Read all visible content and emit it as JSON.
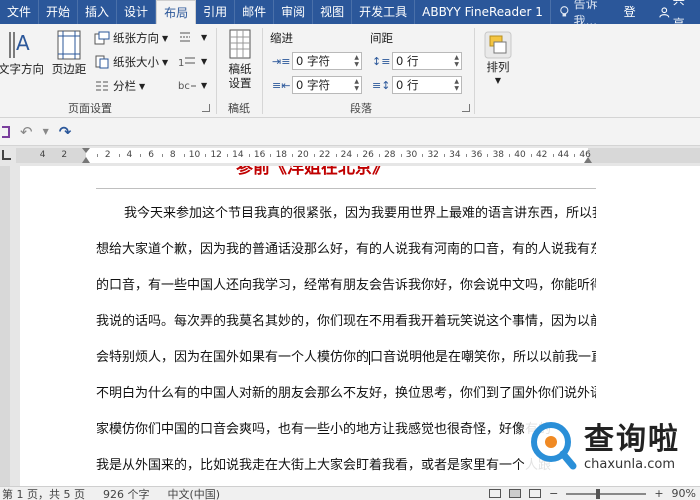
{
  "menu": {
    "tabs": [
      "文件",
      "开始",
      "插入",
      "设计",
      "布局",
      "引用",
      "邮件",
      "审阅",
      "视图",
      "开发工具",
      "ABBYY FineReader 1"
    ],
    "active_tab": "布局",
    "tell_me": "告诉我...",
    "login": "登录",
    "share": "共享"
  },
  "ribbon": {
    "page_setup": {
      "label": "页面设置",
      "text_direction": "文字方向",
      "margins": "页边距",
      "orientation": "纸张方向",
      "size": "纸张大小",
      "columns": "分栏"
    },
    "draft": {
      "label": "稿纸",
      "button": "稿纸\n设置",
      "btn_line1": "稿纸",
      "btn_line2": "设置"
    },
    "paragraph": {
      "label": "段落",
      "indent_label": "缩进",
      "spacing_label": "间距",
      "indent_left": "0 字符",
      "indent_right": "0 字符",
      "spacing_before": "0 行",
      "spacing_after": "0 行"
    },
    "arrange": {
      "label": "排列"
    }
  },
  "document": {
    "heading": "参前《洋姐在北京》",
    "lines": [
      "我今天来参加这个节目我真的很紧张，因为我要用世界上最难的语言讲东西，所以我",
      "想给大家道个歉，因为我的普通话没那么好，有的人说我有河南的口音，有的人说我有东北",
      "的口音，有一些中国人还向我学习，经常有朋友会告诉我你好，你会说中文吗，你能听得懂",
      "我说的话吗。每次弄的我莫名其妙的，你们现在不用看我开着玩笑说这个事情，因为以前我",
      "会特别烦人，因为在国外如果有一个人模仿你的",
      "不明白为什么有的中国人对新的朋友会那么不友好，换位思考，你们到了国外你们说外语大",
      "家模仿你们中国的口音会爽吗，也有一些小的地方让我感觉也很奇怪，好像有的",
      "我是从外国来的，比如说我走在大街上大家会盯着我看，或者是家里有一个人跟"
    ],
    "line5_after_cursor": "口音说明他是在嘲笑你，所以以前我一直搞"
  },
  "ruler": {
    "left_labels": [
      "4",
      "2"
    ],
    "labels": [
      "2",
      "4",
      "6",
      "8",
      "10",
      "12",
      "14",
      "16",
      "18",
      "20",
      "22",
      "24",
      "26",
      "28",
      "30",
      "32",
      "34",
      "36",
      "38",
      "40",
      "42",
      "44",
      "46"
    ]
  },
  "watermark": {
    "title": "查询啦",
    "url": "chaxunla.com"
  },
  "status": {
    "page": "第 1 页，共 5 页",
    "words": "926 个字",
    "language": "中文(中国)",
    "zoom": "90%"
  },
  "colors": {
    "title_bar": "#2b579a",
    "heading": "#c00000",
    "watermark_ring": "#2a8fd8",
    "watermark_dot": "#f08a24"
  }
}
